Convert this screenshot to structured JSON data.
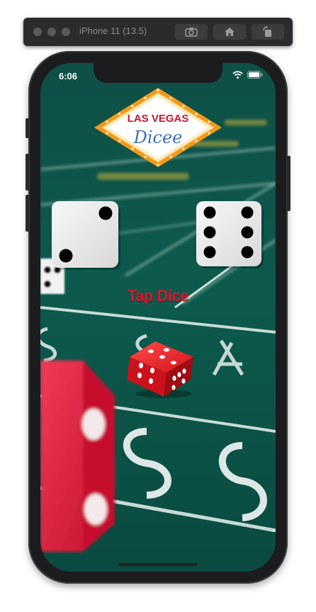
{
  "simulator": {
    "title": "iPhone 11 (13.5)",
    "buttons": [
      "screenshot-icon",
      "home-icon",
      "rotate-icon"
    ]
  },
  "status_bar": {
    "time": "6:06",
    "icons": [
      "wifi-icon",
      "battery-icon"
    ]
  },
  "app": {
    "logo": {
      "line1": "LAS VEGAS",
      "line2": "Dicee"
    },
    "dice": [
      {
        "face": 2
      },
      {
        "face": 6
      }
    ],
    "tap_label": "Tap Dice"
  },
  "colors": {
    "felt": "#0c5449",
    "label_red": "#e8102a",
    "logo_border": "#f3a01c",
    "logo_blue": "#3b6fb6"
  }
}
